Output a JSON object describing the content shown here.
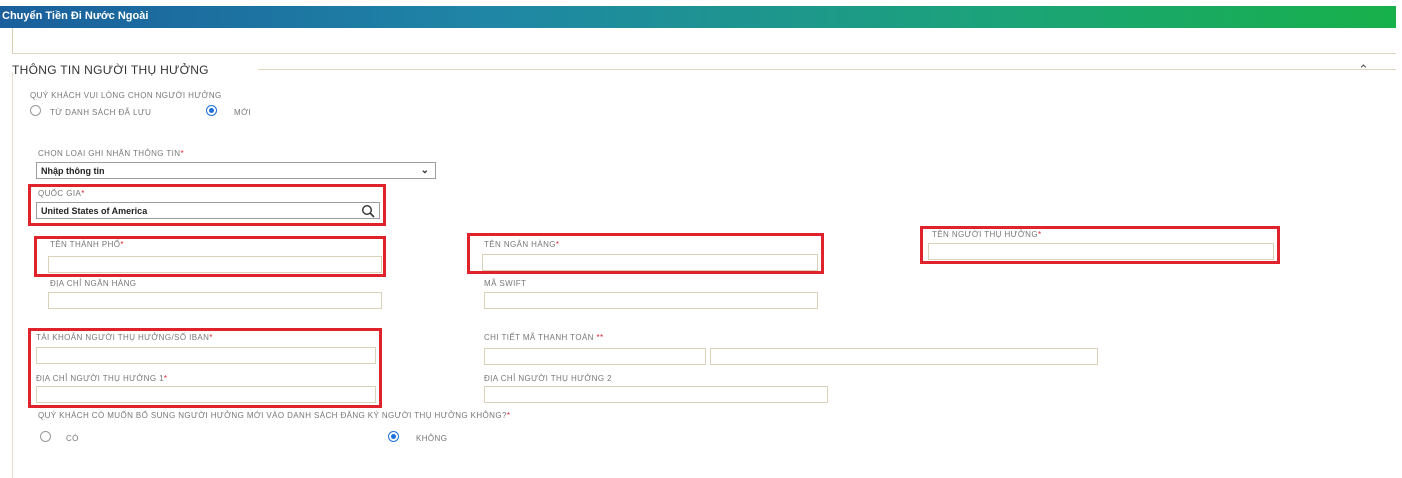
{
  "header": {
    "title": "Chuyển Tiền Đi Nước Ngoài"
  },
  "section": {
    "title": "THÔNG TIN NGƯỜI THỤ HƯỞNG",
    "collapse_icon": "chevron-up-icon"
  },
  "recipient_choice": {
    "label": "QUÝ KHÁCH VUI LÒNG CHỌN NGƯỜI HƯỞNG",
    "options": [
      {
        "label": "TỪ DANH SÁCH ĐÃ LƯU",
        "selected": false
      },
      {
        "label": "MỚI",
        "selected": true
      }
    ]
  },
  "info_type": {
    "label": "CHỌN LOẠI GHI NHẬN THÔNG TIN",
    "value": "Nhập thông tin"
  },
  "country": {
    "label": "QUỐC GIA",
    "value": "United States of America"
  },
  "fields": {
    "city_name": {
      "label": "TÊN THÀNH PHỐ",
      "value": ""
    },
    "bank_name": {
      "label": "TÊN NGÂN HÀNG",
      "value": ""
    },
    "beneficiary_name": {
      "label": "TÊN NGƯỜI THỤ HƯỞNG",
      "value": ""
    },
    "bank_address": {
      "label": "ĐỊA CHỈ NGÂN HÀNG",
      "value": ""
    },
    "swift_code": {
      "label": "MÃ SWIFT",
      "value": ""
    },
    "account_iban": {
      "label": "TÀI KHOẢN NGƯỜI THỤ HƯỞNG/SỐ IBAN",
      "value": ""
    },
    "payment_detail": {
      "label": "CHI TIẾT MÃ THANH TOÁN",
      "value_1": "",
      "value_2": ""
    },
    "address_1": {
      "label": "ĐỊA CHỈ NGƯỜI THỤ HƯỞNG 1",
      "value": ""
    },
    "address_2": {
      "label": "ĐỊA CHỈ NGƯỜI THỤ HƯỞNG 2",
      "value": ""
    }
  },
  "save_beneficiary": {
    "label": "QUÝ KHÁCH CÓ MUỐN BỔ SUNG NGƯỜI HƯỞNG MỚI VÀO DANH SÁCH ĐĂNG KÝ NGƯỜI THỤ HƯỞNG KHÔNG?",
    "options": [
      {
        "label": "CÓ",
        "selected": false
      },
      {
        "label": "KHÔNG",
        "selected": true
      }
    ]
  },
  "colors": {
    "highlight": "#e0222d",
    "header_start": "#1a5f9c",
    "header_end": "#17b14a",
    "radio_active": "#1e6fd9"
  }
}
